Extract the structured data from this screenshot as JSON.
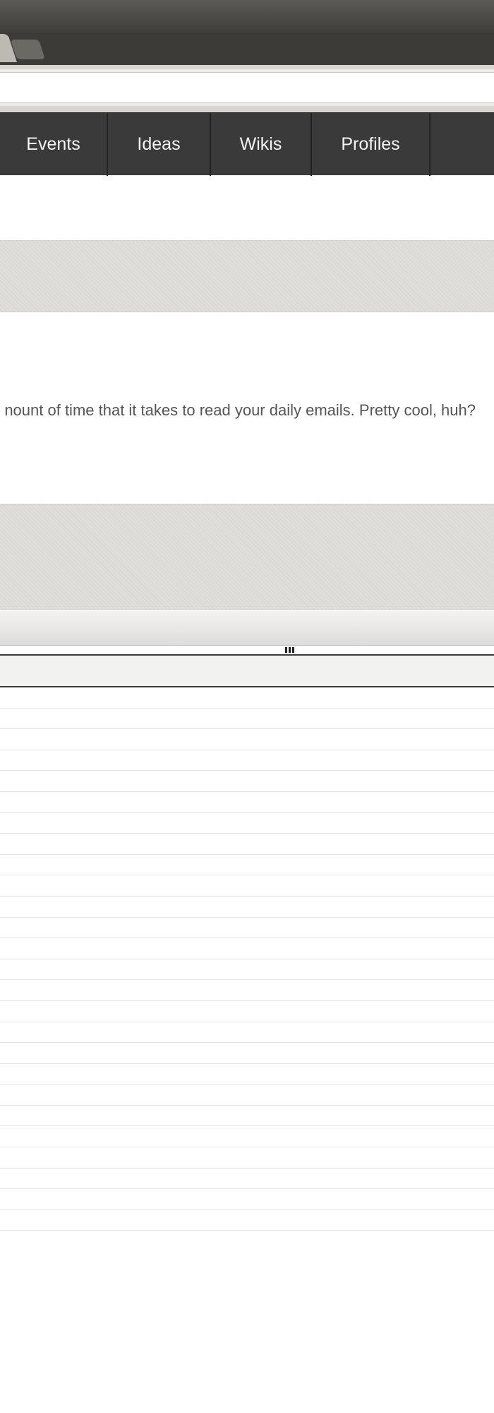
{
  "browser": {
    "tabs": [
      {
        "label": "",
        "state": "active"
      },
      {
        "label": "",
        "state": "new-tab"
      }
    ],
    "address_value": ""
  },
  "site_nav": {
    "items": [
      {
        "label": "Events"
      },
      {
        "label": "Ideas"
      },
      {
        "label": "Wikis"
      },
      {
        "label": "Profiles"
      }
    ]
  },
  "content": {
    "paragraph": "nount of time that it takes to read your daily emails. Pretty cool, huh?"
  },
  "bottom_panel": {
    "row_count": 26
  },
  "colors": {
    "nav_background": "#3a3a3a",
    "nav_text": "#f3f3f3",
    "band_grey": "#deddda",
    "body_text": "#555555"
  }
}
